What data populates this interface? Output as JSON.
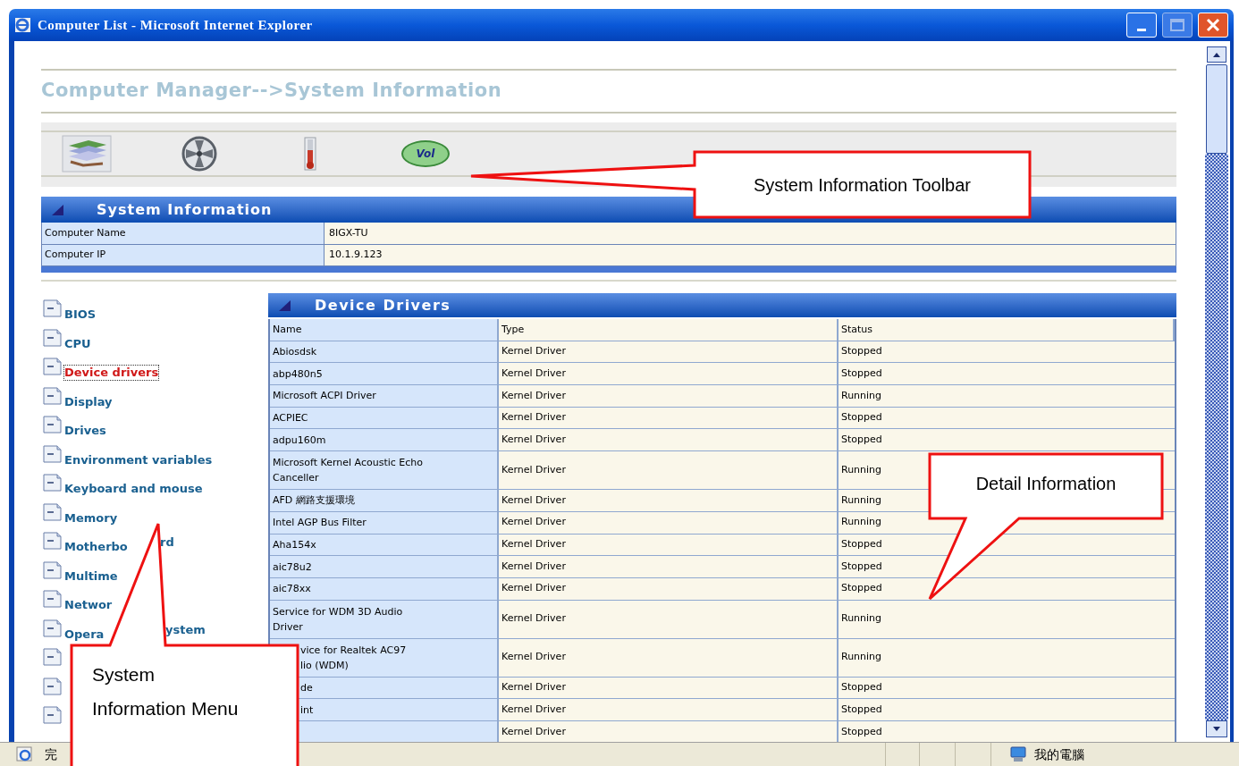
{
  "window": {
    "title": "Computer List - Microsoft Internet Explorer"
  },
  "page": {
    "heading": "Computer Manager-->System Information"
  },
  "toolbar": {
    "items": [
      {
        "kind": "cards"
      },
      {
        "kind": "fan"
      },
      {
        "kind": "thermometer"
      },
      {
        "kind": "volume",
        "text": "Vol"
      }
    ]
  },
  "system_information": {
    "title": "System Information",
    "rows": [
      {
        "label": "Computer Name",
        "value": "8IGX-TU"
      },
      {
        "label": "Computer IP",
        "value": "10.1.9.123"
      }
    ]
  },
  "menu": {
    "items": [
      {
        "label_parts": [
          "BIOS"
        ],
        "selected": false
      },
      {
        "label_parts": [
          "CPU"
        ],
        "selected": false
      },
      {
        "label_parts": [
          "Device drivers"
        ],
        "selected": true
      },
      {
        "label_parts": [
          "Display"
        ],
        "selected": false
      },
      {
        "label_parts": [
          "Drives"
        ],
        "selected": false
      },
      {
        "label_parts": [
          "Environment variables"
        ],
        "selected": false
      },
      {
        "label_parts": [
          "Keyboard and mouse"
        ],
        "selected": false
      },
      {
        "label_parts": [
          "Memory"
        ],
        "selected": false
      },
      {
        "label_parts": [
          "Motherbo",
          "rd"
        ],
        "selected": false
      },
      {
        "label_parts": [
          "Multime"
        ],
        "selected": false
      },
      {
        "label_parts": [
          "Networ"
        ],
        "selected": false
      },
      {
        "label_parts": [
          "Opera",
          "ystem"
        ],
        "selected": false
      },
      {
        "kind": "icon"
      },
      {
        "kind": "icon"
      },
      {
        "kind": "icon"
      }
    ]
  },
  "device_drivers": {
    "title": "Device Drivers",
    "columns": [
      "Name",
      "Type",
      "Status"
    ],
    "rows": [
      {
        "name": "Abiosdsk",
        "type": "Kernel Driver",
        "status": "Stopped"
      },
      {
        "name": "abp480n5",
        "type": "Kernel Driver",
        "status": "Stopped"
      },
      {
        "name": "Microsoft ACPI Driver",
        "type": "Kernel Driver",
        "status": "Running"
      },
      {
        "name": "ACPIEC",
        "type": "Kernel Driver",
        "status": "Stopped"
      },
      {
        "name": "adpu160m",
        "type": "Kernel Driver",
        "status": "Stopped"
      },
      {
        "name": "Microsoft Kernel Acoustic Echo\nCanceller",
        "type": "Kernel Driver",
        "status": "Running"
      },
      {
        "name": "AFD 網路支援環境",
        "type": "Kernel Driver",
        "status": "Running"
      },
      {
        "name": "Intel AGP Bus Filter",
        "type": "Kernel Driver",
        "status": "Running"
      },
      {
        "name": "Aha154x",
        "type": "Kernel Driver",
        "status": "Stopped"
      },
      {
        "name": "aic78u2",
        "type": "Kernel Driver",
        "status": "Stopped"
      },
      {
        "name": "aic78xx",
        "type": "Kernel Driver",
        "status": "Stopped"
      },
      {
        "name": "Service for WDM 3D Audio\nDriver",
        "type": "Kernel Driver",
        "status": "Running"
      },
      {
        "name": "vice for Realtek AC97\nlio (WDM)",
        "clipped": true,
        "type": "Kernel Driver",
        "status": "Running"
      },
      {
        "name": "de",
        "clipped": true,
        "type": "Kernel Driver",
        "status": "Stopped"
      },
      {
        "name": "int",
        "clipped": true,
        "type": "Kernel Driver",
        "status": "Stopped"
      },
      {
        "type": "Kernel Driver",
        "status": "Stopped"
      }
    ]
  },
  "status_bar": {
    "text": "完",
    "zone": "我的電腦"
  },
  "callouts": [
    {
      "text": "System Information Toolbar"
    },
    {
      "text": "Detail Information"
    },
    {
      "text": "System\nInformation Menu"
    }
  ]
}
